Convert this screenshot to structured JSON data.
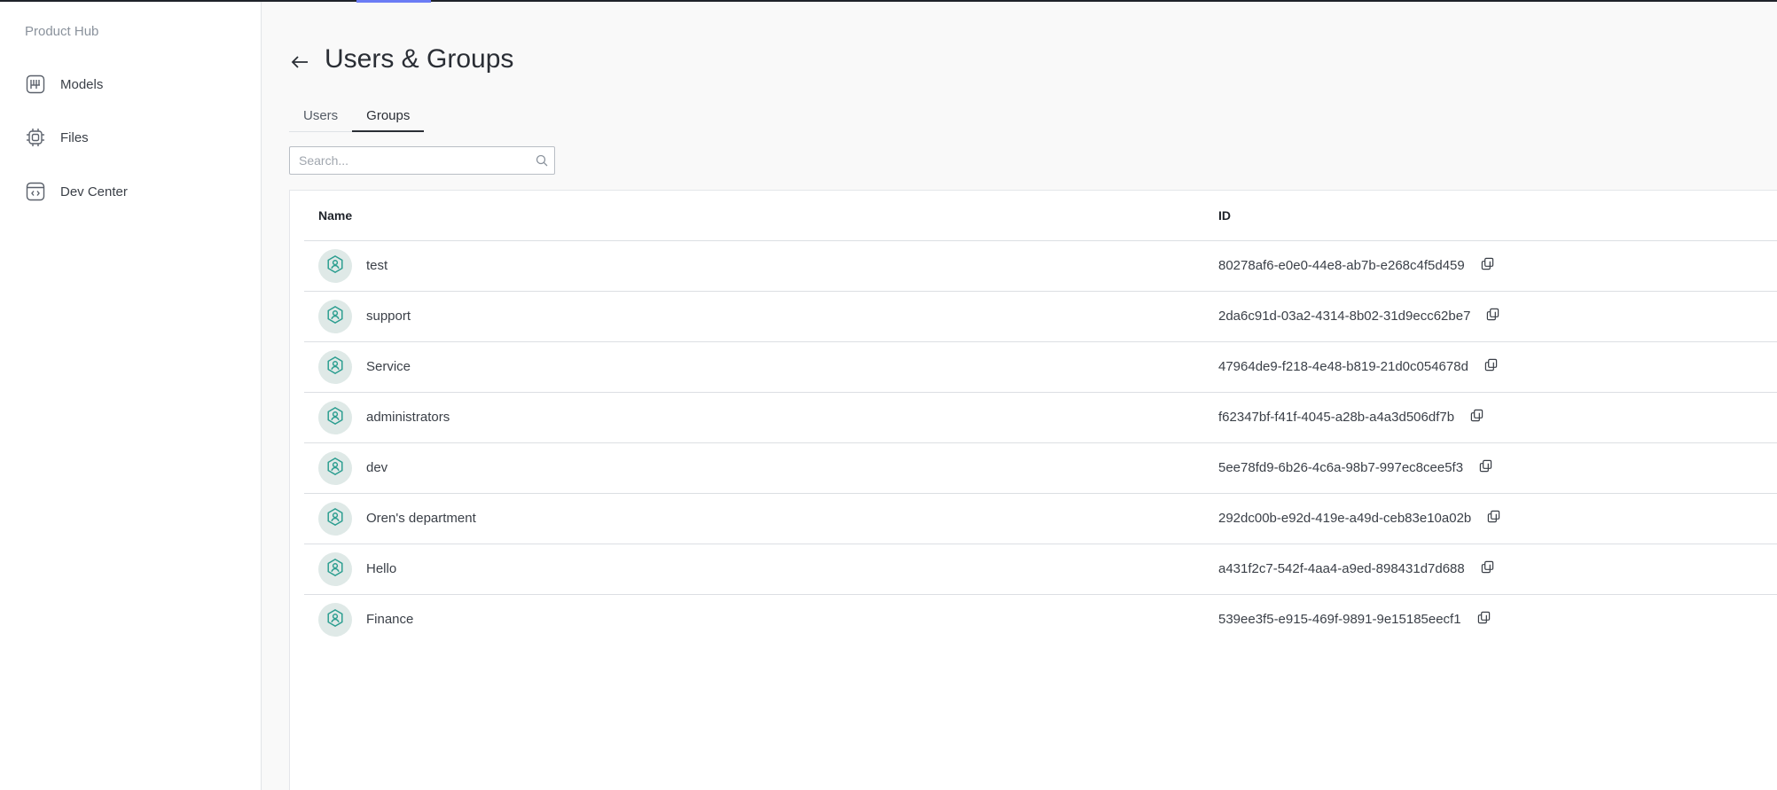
{
  "sidebar": {
    "brand": "Product Hub",
    "items": [
      {
        "label": "Models",
        "icon": "models-icon"
      },
      {
        "label": "Files",
        "icon": "chip-icon"
      },
      {
        "label": "Dev Center",
        "icon": "code-window-icon"
      }
    ]
  },
  "header": {
    "title": "Users & Groups",
    "back_icon": "arrow-left-icon"
  },
  "tabs": [
    {
      "label": "Users",
      "active": false
    },
    {
      "label": "Groups",
      "active": true
    }
  ],
  "search": {
    "placeholder": "Search...",
    "value": "",
    "icon": "search-icon"
  },
  "table": {
    "columns": [
      "Name",
      "ID"
    ],
    "rows": [
      {
        "name": "test",
        "id": "80278af6-e0e0-44e8-ab7b-e268c4f5d459"
      },
      {
        "name": "support",
        "id": "2da6c91d-03a2-4314-8b02-31d9ecc62be7"
      },
      {
        "name": "Service",
        "id": "47964de9-f218-4e48-b819-21d0c054678d"
      },
      {
        "name": "administrators",
        "id": "f62347bf-f41f-4045-a28b-a4a3d506df7b"
      },
      {
        "name": "dev",
        "id": "5ee78fd9-6b26-4c6a-98b7-997ec8cee5f3"
      },
      {
        "name": "Oren's department",
        "id": "292dc00b-e92d-419e-a49d-ceb83e10a02b"
      },
      {
        "name": "Hello",
        "id": "a431f2c7-542f-4aa4-a9ed-898431d7d688"
      },
      {
        "name": "Finance",
        "id": "539ee3f5-e915-469f-9891-9e15185eecf1"
      }
    ]
  },
  "colors": {
    "accent": "#6b7cf5",
    "group_icon": "#2a9d8f",
    "avatar_bg": "#dfe9e7"
  }
}
